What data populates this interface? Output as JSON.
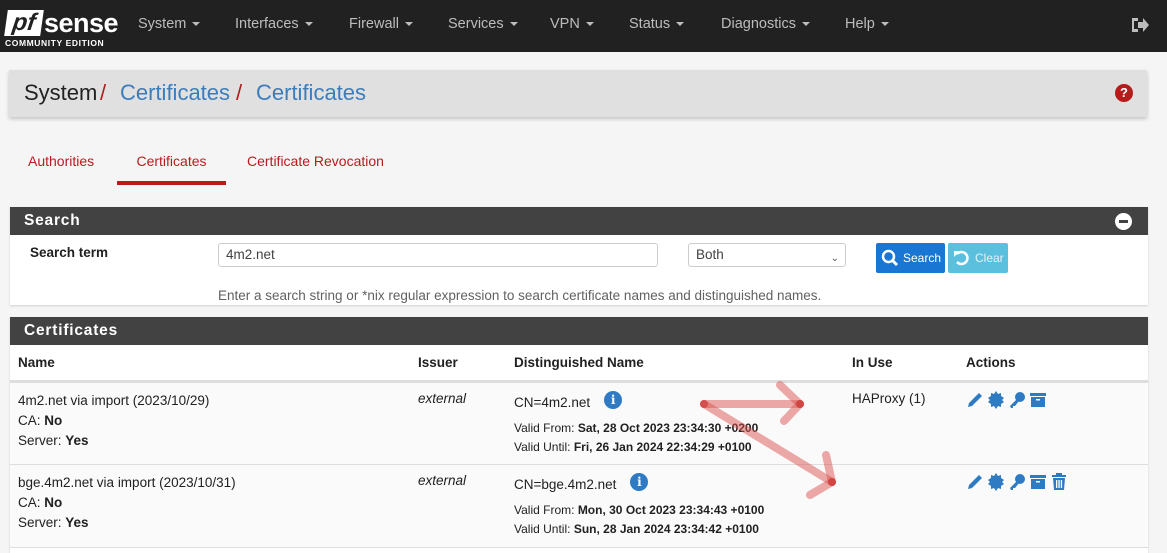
{
  "navbar": {
    "logo_mark": "pf",
    "logo_text": "sense",
    "edition": "COMMUNITY EDITION",
    "menu": [
      "System",
      "Interfaces",
      "Firewall",
      "Services",
      "VPN",
      "Status",
      "Diagnostics",
      "Help"
    ],
    "logout_icon": "sign-out-icon"
  },
  "breadcrumb": {
    "root": "System",
    "sep": "/",
    "level1": "Certificates",
    "level2": "Certificates"
  },
  "tabs": [
    {
      "label": "Authorities",
      "active": false
    },
    {
      "label": "Certificates",
      "active": true
    },
    {
      "label": "Certificate Revocation",
      "active": false
    }
  ],
  "search_panel": {
    "title": "Search",
    "term_label": "Search term",
    "term_value": "4m2.net",
    "scope_value": "Both",
    "search_button": "Search",
    "clear_button": "Clear",
    "help": "Enter a search string or *nix regular expression to search certificate names and distinguished names."
  },
  "certs_panel": {
    "title": "Certificates",
    "columns": [
      "Name",
      "Issuer",
      "Distinguished Name",
      "In Use",
      "Actions"
    ],
    "rows": [
      {
        "name": "4m2.net via import (2023/10/29)",
        "ca_label": "CA:",
        "ca": "No",
        "server_label": "Server:",
        "server": "Yes",
        "issuer": "external",
        "dn": "CN=4m2.net",
        "valid_from_label": "Valid From:",
        "valid_from": "Sat, 28 Oct 2023 23:34:30 +0200",
        "valid_until_label": "Valid Until:",
        "valid_until": "Fri, 26 Jan 2024 22:34:29 +0100",
        "in_use": "HAProxy (1)",
        "actions": [
          "edit",
          "export-cert",
          "export-key",
          "export-p12"
        ]
      },
      {
        "name": "bge.4m2.net via import (2023/10/31)",
        "ca_label": "CA:",
        "ca": "No",
        "server_label": "Server:",
        "server": "Yes",
        "issuer": "external",
        "dn": "CN=bge.4m2.net",
        "valid_from_label": "Valid From:",
        "valid_from": "Mon, 30 Oct 2023 23:34:43 +0100",
        "valid_until_label": "Valid Until:",
        "valid_until": "Sun, 28 Jan 2024 23:34:42 +0100",
        "in_use": "",
        "actions": [
          "edit",
          "export-cert",
          "export-key",
          "export-p12",
          "delete"
        ]
      }
    ]
  },
  "colors": {
    "navbar": "#212121",
    "accent_red": "#b71c1c",
    "link_blue": "#3a7dbf",
    "icon_blue": "#2e7bc4",
    "annotation": "#d9534f"
  }
}
